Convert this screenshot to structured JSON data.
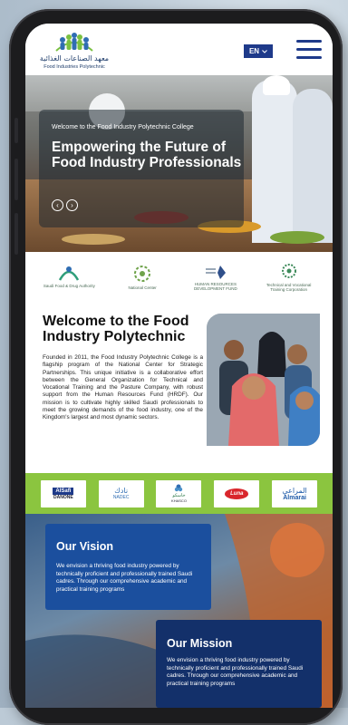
{
  "header": {
    "logo_arabic": "معهد الصناعات الغذائية",
    "logo_english": "Food Industries Polytechnic",
    "language": "EN"
  },
  "hero": {
    "kicker": "Welcome to the Food Industry Polytechnic College",
    "title": "Empowering the Future of Food Industry Professionals",
    "prev_icon": "chevron-left-icon",
    "next_icon": "chevron-right-icon"
  },
  "partners": [
    {
      "name": "saudi-food-drug-authority-logo",
      "label": "Saudi Food & Drug Authority"
    },
    {
      "name": "national-center-logo",
      "label": "National Center"
    },
    {
      "name": "human-resources-fund-logo",
      "label": "HUMAN RESOURCES DEVELOPMENT FUND"
    },
    {
      "name": "tvtc-logo",
      "label": "Technical and Vocational Training Corporation"
    }
  ],
  "welcome": {
    "title": "Welcome to the Food Industry Polytechnic",
    "body": "Founded in 2011, the Food Industry Polytechnic College is a flagship program of the National Center for Strategic Partnerships. This unique initiative is a collaborative effort between the General Organization for Technical and Vocational Training and the Pasture Company, with robust support from the Human Resources Fund (HRDF). Our mission is to cultivate highly skilled Saudi professionals to meet the growing demands of the food industry, one of the Kingdom's largest and most dynamic sectors."
  },
  "brands": [
    {
      "name": "alsafi-danone-logo",
      "line1": "AlSafi",
      "line2": "DANONE"
    },
    {
      "name": "nadec-logo",
      "line1": "نادك",
      "line2": "NADEC"
    },
    {
      "name": "khasco-logo",
      "line1": "خاسكو",
      "line2": "KHASCO"
    },
    {
      "name": "luna-logo",
      "line1": "Luna",
      "line2": ""
    },
    {
      "name": "almarai-logo",
      "line1": "المراعي",
      "line2": "Almarai"
    }
  ],
  "vision": {
    "title": "Our Vision",
    "body": "We envision a thriving food industry powered by technically proficient and professionally trained Saudi cadres. Through our comprehensive academic and practical training programs"
  },
  "mission": {
    "title": "Our Mission",
    "body": "We envision a thriving food industry powered by technically proficient and professionally trained Saudi cadres. Through our comprehensive academic and practical training programs"
  },
  "colors": {
    "brand_navy": "#1e3a8a",
    "accent_green": "#8bc53f",
    "vision_blue": "#1b4f9e",
    "mission_navy": "#13306a"
  }
}
